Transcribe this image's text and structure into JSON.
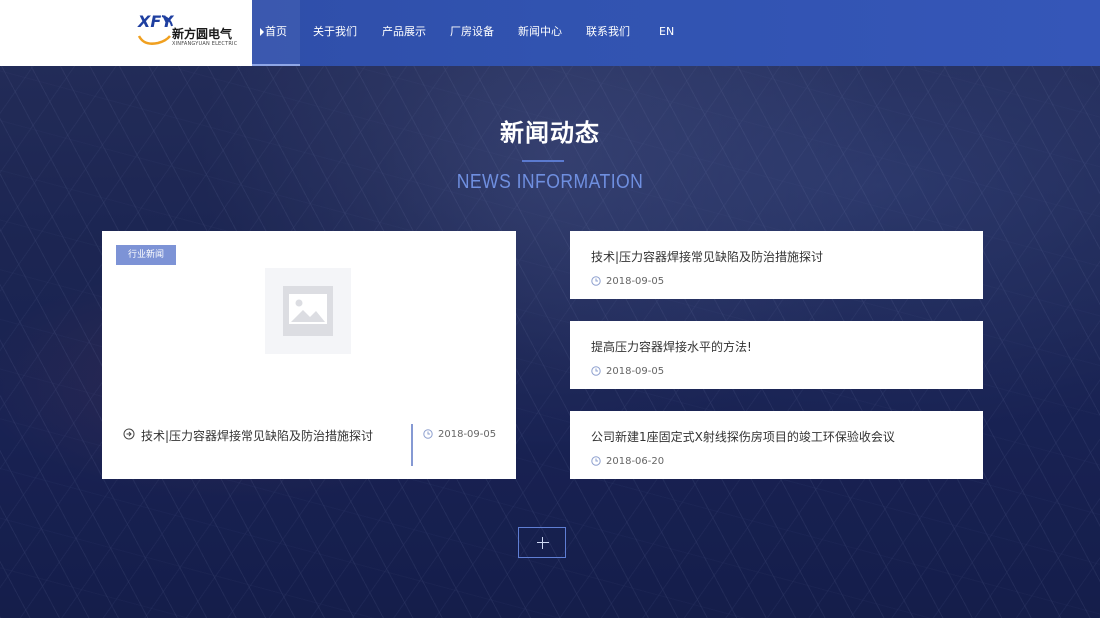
{
  "brand": {
    "mark": "XFY",
    "name_cn": "新方圆电气",
    "name_en": "XINFANGYUAN ELECTRIC"
  },
  "nav": {
    "items": [
      {
        "label": "首页",
        "active": true
      },
      {
        "label": "关于我们",
        "active": false
      },
      {
        "label": "产品展示",
        "active": false
      },
      {
        "label": "厂房设备",
        "active": false
      },
      {
        "label": "新闻中心",
        "active": false
      },
      {
        "label": "联系我们",
        "active": false
      },
      {
        "label": "EN",
        "active": false
      }
    ]
  },
  "section": {
    "title": "新闻动态",
    "subtitle": "NEWS INFORMATION"
  },
  "featured": {
    "badge": "行业新闻",
    "title": "技术|压力容器焊接常见缺陷及防治措施探讨",
    "date": "2018-09-05",
    "image_icon": "image-placeholder-icon"
  },
  "news": [
    {
      "title": "技术|压力容器焊接常见缺陷及防治措施探讨",
      "date": "2018-09-05"
    },
    {
      "title": "提高压力容器焊接水平的方法!",
      "date": "2018-09-05"
    },
    {
      "title": "公司新建1座固定式X射线探伤房项目的竣工环保验收会议",
      "date": "2018-06-20"
    }
  ],
  "more_button": {
    "icon": "plus-icon"
  },
  "colors": {
    "header": "#3153b0",
    "accent": "#5b7ad0",
    "subtitle": "#6f8fe0",
    "badge": "#7d93d6"
  }
}
